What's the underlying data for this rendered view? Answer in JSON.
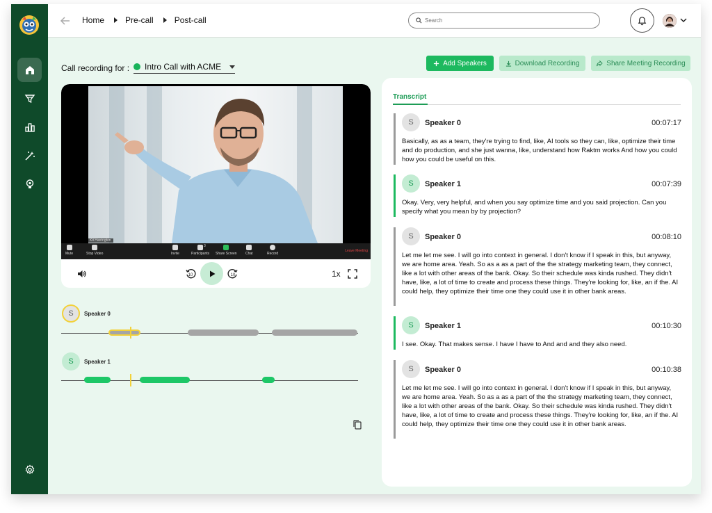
{
  "header": {
    "breadcrumbs": [
      "Home",
      "Pre-call",
      "Post-call"
    ],
    "search_placeholder": "Search"
  },
  "toolbar": {
    "recording_label": "Call recording for :",
    "recording_selected": "Intro Call with ACME",
    "add_speakers": "Add Speakers",
    "download_recording": "Download Recording",
    "share_meeting_recording": "Share Meeting Recording"
  },
  "video": {
    "name_tag": "Kit Harrington",
    "zoom_controls": [
      "Mute",
      "Stop Video",
      "Invite",
      "Participants",
      "Share Screen",
      "Chat",
      "Record"
    ],
    "participants_count": "3",
    "leave_label": "Leave Meeting",
    "speed": "1x"
  },
  "timeline": {
    "speakers": [
      {
        "initial": "S",
        "name": "Speaker 0"
      },
      {
        "initial": "S",
        "name": "Speaker 1"
      }
    ]
  },
  "transcript": {
    "tab_label": "Transcript",
    "entries": [
      {
        "initial": "S",
        "speaker": "Speaker 0",
        "time": "00:07:17",
        "text": "Basically, as as a team, they're trying to find, like, AI tools so they can, like, optimize their time and do production, and she just wanna, like, understand how Raktm works And how you could how you could be useful on this."
      },
      {
        "initial": "S",
        "speaker": "Speaker 1",
        "time": "00:07:39",
        "text": "Okay. Very, very helpful, and when you say optimize time and you said projection. Can you specify what you mean by by projection?"
      },
      {
        "initial": "S",
        "speaker": "Speaker 0",
        "time": "00:08:10",
        "text": "Let me let me see. I will go into context in general. I don't know if I speak in this, but anyway, we are home area. Yeah. So as a as a part of the the strategy marketing team, they connect, like a lot with other areas of the bank. Okay. So their schedule was kinda rushed. They didn't have, like, a lot of time to create and process these things. They're looking for, like, an if the. AI could help, they optimize their time one they could use it in other bank areas."
      },
      {
        "initial": "S",
        "speaker": "Speaker 1",
        "time": "00:10:30",
        "text": "I see. Okay. That makes sense. I have I have to And and and they also need."
      },
      {
        "initial": "S",
        "speaker": "Speaker 0",
        "time": "00:10:38",
        "text": "Let me let me see. I will go into context in general. I don't know if I speak in this, but anyway, we are home area. Yeah. So as a as a part of the the strategy marketing team, they connect, like a lot with other areas of the bank. Okay. So their schedule was kinda rushed. They didn't have, like, a lot of time to create and process these things. They're looking for, like, an if the. AI could help, they optimize their time one they could use it in other bank areas."
      }
    ]
  },
  "colors": {
    "sidebar": "#0f4a2a",
    "accent": "#1db95f",
    "accent_light": "#b9e9cb",
    "background": "#eaf7ef",
    "speaker0_segment": "#a5a5a5",
    "playhead": "#f2d13a"
  },
  "icons": [
    "home-icon",
    "funnel-icon",
    "bar-chart-icon",
    "magic-wand-icon",
    "lightbulb-icon",
    "settings-icon",
    "bell-icon",
    "search-icon",
    "volume-icon",
    "rewind-10-icon",
    "play-icon",
    "forward-10-icon",
    "fullscreen-icon",
    "copy-icon"
  ]
}
